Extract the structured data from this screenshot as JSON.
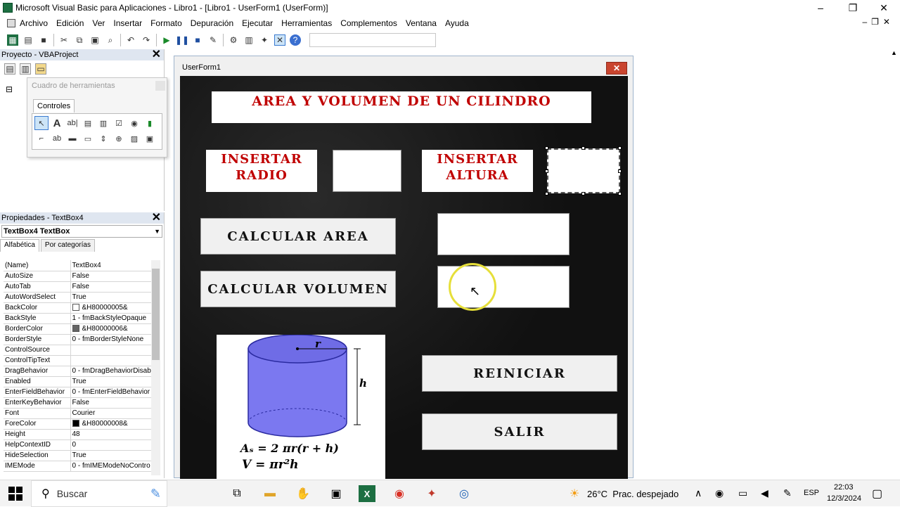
{
  "window": {
    "title": "Microsoft Visual Basic para Aplicaciones - Libro1 - [Libro1 - UserForm1 (UserForm)]",
    "minimize": "–",
    "maximize": "❐",
    "close": "✕"
  },
  "menu": {
    "items": [
      "Archivo",
      "Edición",
      "Ver",
      "Insertar",
      "Formato",
      "Depuración",
      "Ejecutar",
      "Herramientas",
      "Complementos",
      "Ventana",
      "Ayuda"
    ],
    "right_controls": "–❐✕"
  },
  "project_pane": {
    "title": "Proyecto - VBAProject",
    "close": "✕"
  },
  "toolbox": {
    "title": "Cuadro de herramientas",
    "tab": "Controles"
  },
  "properties_pane": {
    "title": "Propiedades - TextBox4",
    "close": "✕",
    "object": "TextBox4 TextBox",
    "tabs": [
      "Alfabética",
      "Por categorías"
    ],
    "rows": [
      {
        "name": "(Name)",
        "value": "TextBox4"
      },
      {
        "name": "AutoSize",
        "value": "False"
      },
      {
        "name": "AutoTab",
        "value": "False"
      },
      {
        "name": "AutoWordSelect",
        "value": "True"
      },
      {
        "name": "BackColor",
        "value": "&H80000005&",
        "swatch": "#ffffff"
      },
      {
        "name": "BackStyle",
        "value": "1 - fmBackStyleOpaque"
      },
      {
        "name": "BorderColor",
        "value": "&H80000006&",
        "swatch": "#646464"
      },
      {
        "name": "BorderStyle",
        "value": "0 - fmBorderStyleNone"
      },
      {
        "name": "ControlSource",
        "value": ""
      },
      {
        "name": "ControlTipText",
        "value": ""
      },
      {
        "name": "DragBehavior",
        "value": "0 - fmDragBehaviorDisab"
      },
      {
        "name": "Enabled",
        "value": "True"
      },
      {
        "name": "EnterFieldBehavior",
        "value": "0 - fmEnterFieldBehavior"
      },
      {
        "name": "EnterKeyBehavior",
        "value": "False"
      },
      {
        "name": "Font",
        "value": "Courier"
      },
      {
        "name": "ForeColor",
        "value": "&H80000008&",
        "swatch": "#000000"
      },
      {
        "name": "Height",
        "value": "48"
      },
      {
        "name": "HelpContextID",
        "value": "0"
      },
      {
        "name": "HideSelection",
        "value": "True"
      },
      {
        "name": "IMEMode",
        "value": "0 - fmIMEModeNoContro"
      }
    ]
  },
  "userform": {
    "title": "UserForm1",
    "close": "✕",
    "heading": "AREA Y VOLUMEN DE UN CILINDRO",
    "label_radio": "INSERTAR RADIO",
    "label_altura": "INSERTAR ALTURA",
    "btn_area": "CALCULAR AREA",
    "btn_volumen": "CALCULAR VOLUMEN",
    "btn_reiniciar": "REINICIAR",
    "btn_salir": "SALIR",
    "image": {
      "r_label": "r",
      "h_label": "h",
      "formula_area": "Aₛ = 2 πr(r + h)",
      "formula_volume": "V = πr²h"
    }
  },
  "taskbar": {
    "search_placeholder": "Buscar",
    "weather": "26°C  Prac. despejado",
    "lang": "ESP",
    "time": "22:03",
    "date": "12/3/2024"
  },
  "colors": {
    "label_red": "#c00000",
    "form_bg": "#111111",
    "cylinder": "#7b78f0"
  }
}
